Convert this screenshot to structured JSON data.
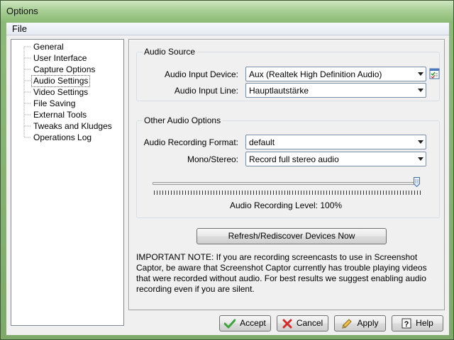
{
  "window": {
    "title": "Options"
  },
  "menu": {
    "file": "File"
  },
  "sidebar": {
    "items": [
      {
        "label": "General",
        "selected": false
      },
      {
        "label": "User Interface",
        "selected": false
      },
      {
        "label": "Capture Options",
        "selected": false
      },
      {
        "label": "Audio Settings",
        "selected": true
      },
      {
        "label": "Video Settings",
        "selected": false
      },
      {
        "label": "File Saving",
        "selected": false
      },
      {
        "label": "External Tools",
        "selected": false
      },
      {
        "label": "Tweaks and Kludges",
        "selected": false
      },
      {
        "label": "Operations Log",
        "selected": false
      }
    ]
  },
  "audio_source": {
    "title": "Audio Source",
    "device_label": "Audio Input Device:",
    "device_value": "Aux (Realtek High Definition Audio)",
    "line_label": "Audio Input Line:",
    "line_value": "Hauptlautstärke"
  },
  "other_options": {
    "title": "Other Audio Options",
    "format_label": "Audio Recording Format:",
    "format_value": "default",
    "mono_label": "Mono/Stereo:",
    "mono_value": "Record full stereo audio",
    "level_label": "Audio Recording Level: 100%",
    "level_fraction": 1.0
  },
  "refresh_button": "Refresh/Rediscover Devices Now",
  "note": "IMPORTANT NOTE: If you are recording screencasts to use in Screenshot Captor, be aware that Screenshot Captor currently has trouble playing videos that were recorded without audio.  For best results we suggest enabling audio recording even if you are silent.",
  "buttons": {
    "accept": "Accept",
    "cancel": "Cancel",
    "apply": "Apply",
    "help": "Help"
  },
  "colors": {
    "accept_icon": "#3aa53a",
    "cancel_icon": "#d22a2a"
  }
}
